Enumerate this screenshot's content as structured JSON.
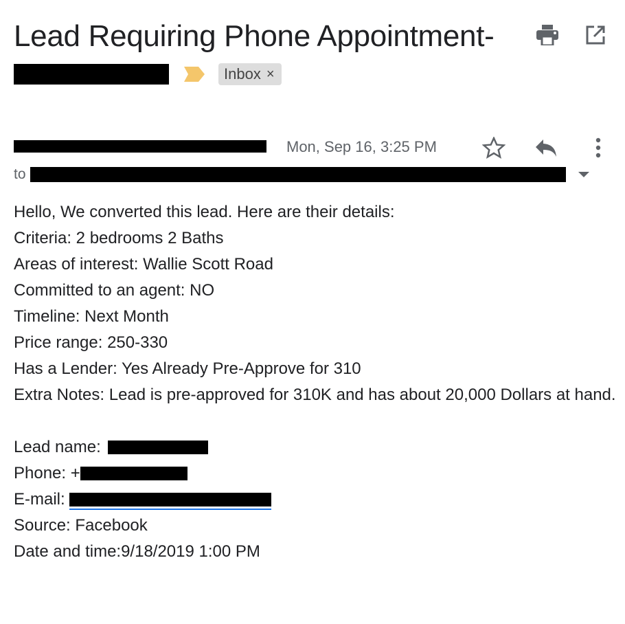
{
  "email": {
    "subject_line1": "Lead Requiring Phone Appointment-",
    "label_chip": "Inbox",
    "chip_close": "×",
    "date": "Mon, Sep 16, 3:25 PM",
    "to_label": "to"
  },
  "body": {
    "greeting": "Hello, We converted this lead. Here are their details:",
    "criteria": "Criteria: 2 bedrooms 2 Baths",
    "areas": "Areas of interest: Wallie Scott Road",
    "committed": "Committed to an agent: NO",
    "timeline": "Timeline: Next Month",
    "price": "Price range: 250-330",
    "lender": "Has a Lender: Yes Already Pre-Approve for 310",
    "notes": "Extra Notes: Lead is pre-approved for 310K and has about 20,000 Dollars at hand.",
    "lead_name_label": "Lead name:",
    "phone_label": "Phone: +",
    "email_label": "E-mail:",
    "source": "Source: Facebook",
    "datetime": "Date and time:9/18/2019 1:00 PM"
  },
  "colors": {
    "label_tag": "#f4c66b",
    "link": "#1a73e8",
    "secondary_text": "#5f6368"
  },
  "icons": [
    "print-icon",
    "open-new-window-icon",
    "star-icon",
    "reply-icon",
    "more-vert-icon",
    "label-arrow-icon",
    "dropdown-caret-icon"
  ]
}
